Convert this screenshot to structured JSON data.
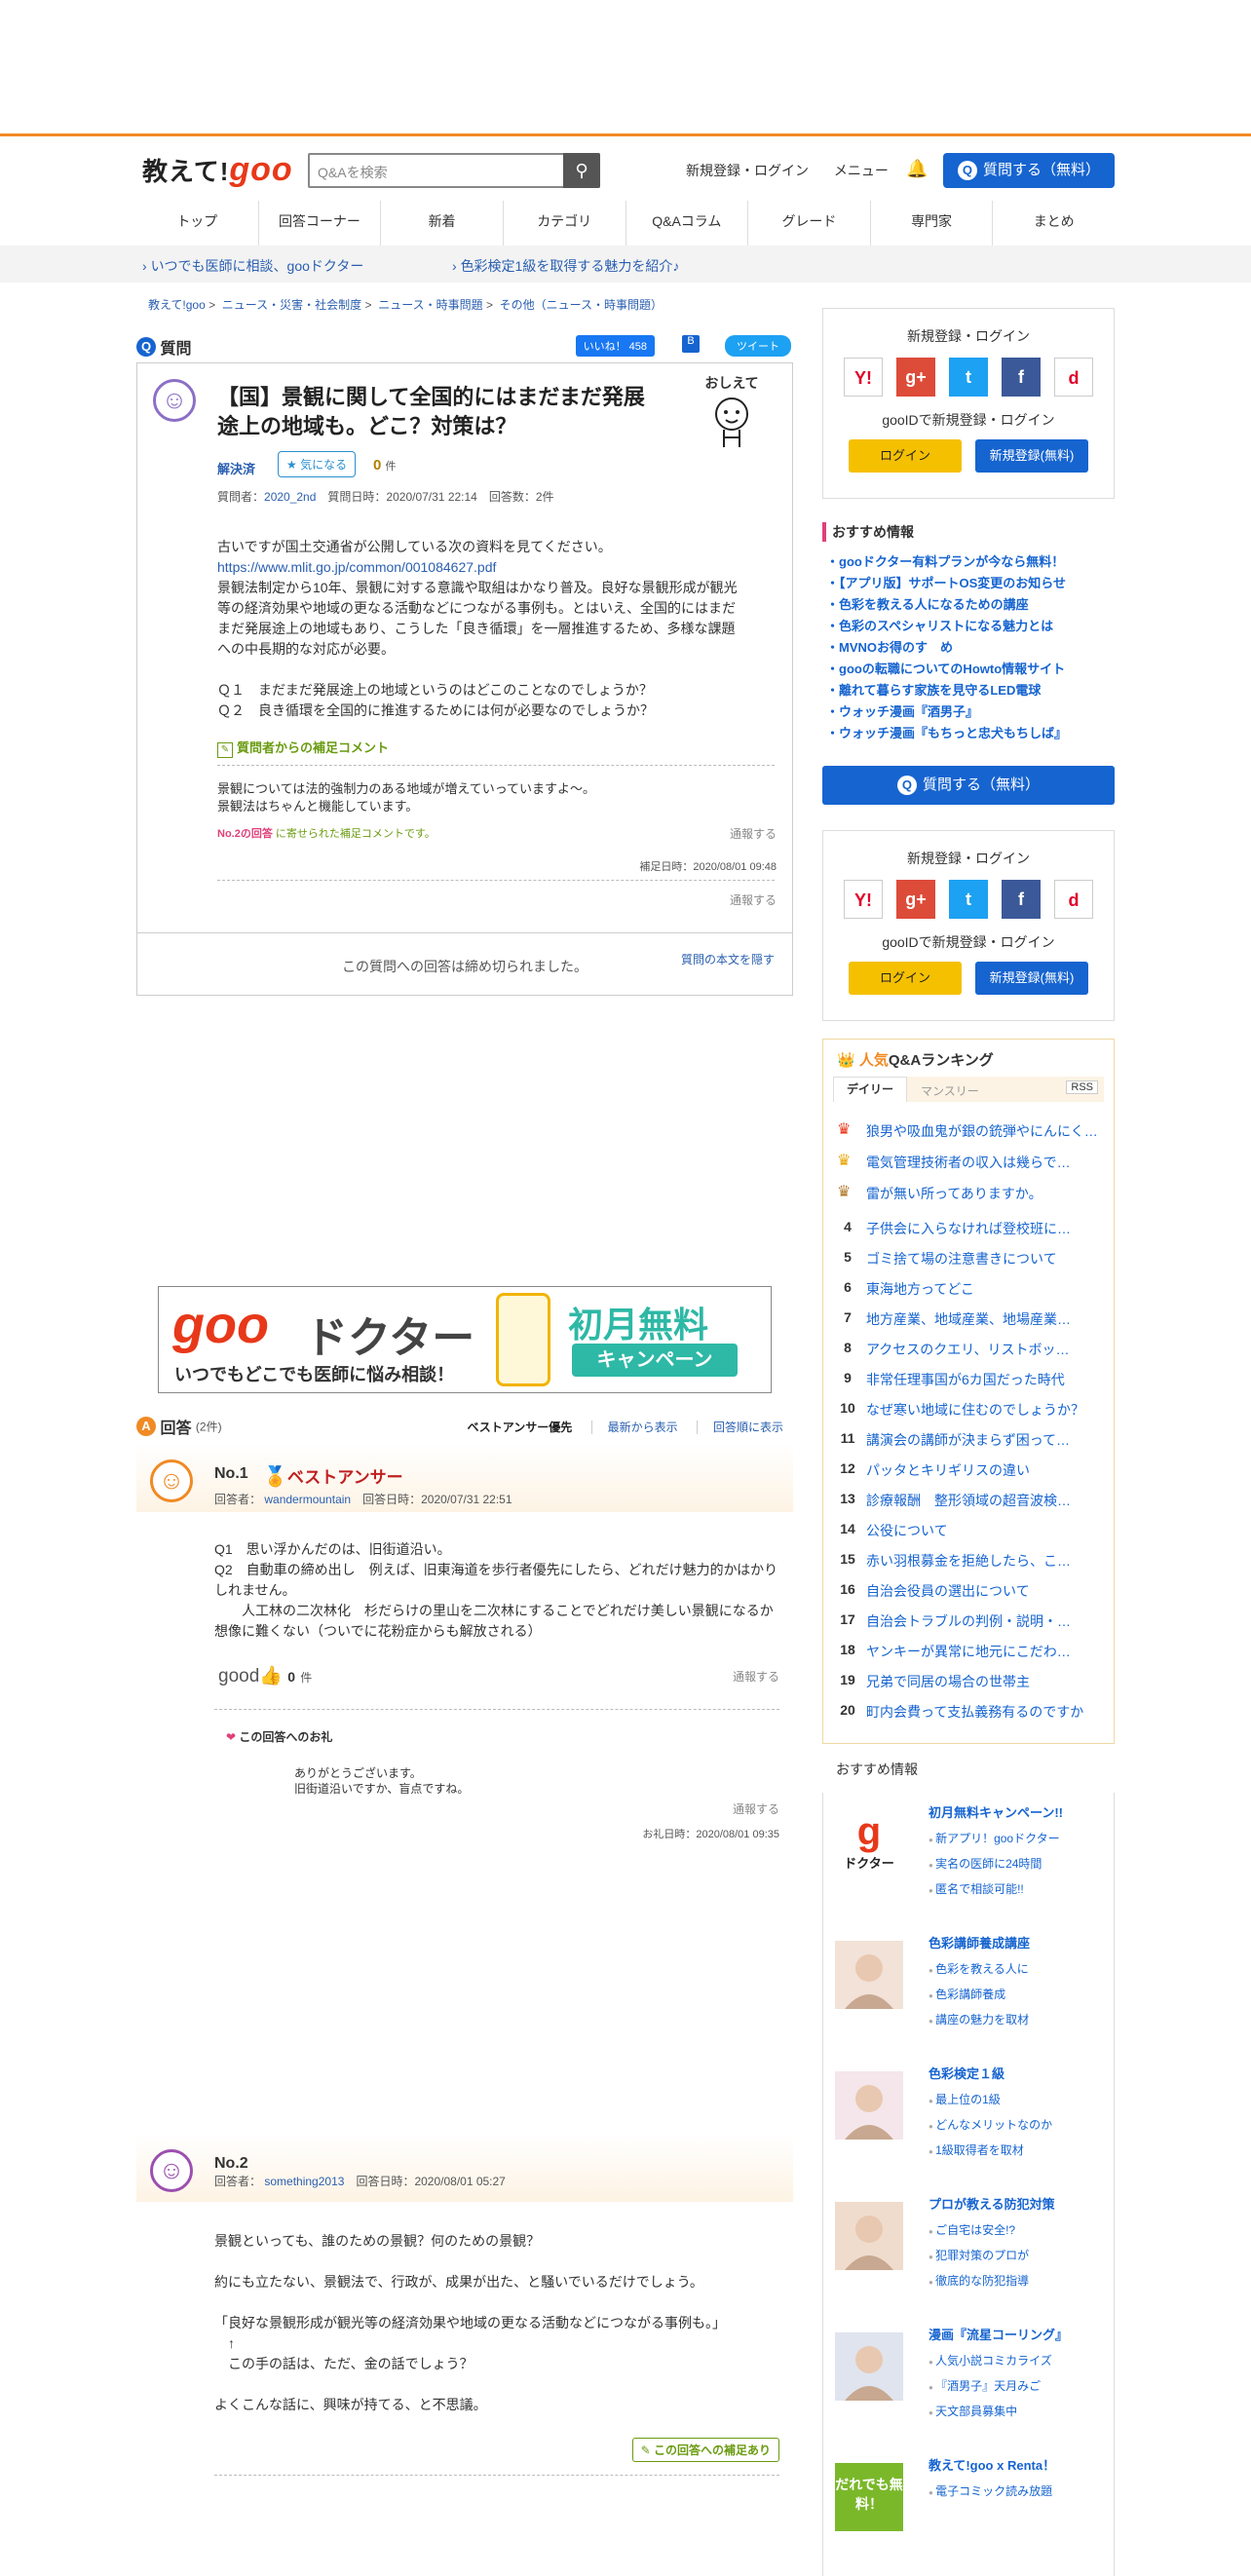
{
  "header": {
    "logo_text": "教えて!",
    "logo_goo": "goo",
    "search_placeholder": "Q&Aを検索",
    "link_login": "新規登録・ログイン",
    "link_menu": "メニュー",
    "ask_button": "質問する（無料）"
  },
  "nav": [
    "トップ",
    "回答コーナー",
    "新着",
    "カテゴリ",
    "Q&Aコラム",
    "グレード",
    "専門家",
    "まとめ"
  ],
  "promo": [
    "いつでも医師に相談、gooドクター",
    "色彩検定1級を取得する魅力を紹介♪"
  ],
  "breadcrumb": [
    "教えて!goo",
    "ニュース・災害・社会制度",
    "ニュース・時事問題",
    "その他（ニュース・時事問題）"
  ],
  "question": {
    "section_label": "質問",
    "like_label": "いいね！ 458",
    "tweet_label": "ツイート",
    "title": "【国】景観に関して全国的にはまだまだ発展途上の地域も。どこ？対策は？",
    "mascot_text": "おしえて",
    "status": "解決済",
    "kininaru_label": "気になる",
    "kininaru_count": "0",
    "kininaru_unit": "件",
    "meta_prefix": "質問者：",
    "author": "2020_2nd",
    "meta_rest": "質問日時：2020/07/31 22:14　回答数：2件",
    "body_1": "古いですが国土交通省が公開している次の資料を見てください。",
    "body_link": "https://www.mlit.go.jp/common/001084627.pdf",
    "body_2": "景観法制定から10年、景観に対する意識や取組はかなり普及。良好な景観形成が観光等の経済効果や地域の更なる活動などにつながる事例も。とはいえ、全国的にはまだまだ発展途上の地域もあり、こうした「良き循環」を一層推進するため、多様な課題への中長期的な対応が必要。",
    "q1": "Ｑ１　まだまだ発展途上の地域というのはどこのことなのでしょうか？",
    "q2": "Ｑ２　良き循環を全国的に推進するためには何が必要なのでしょうか？",
    "supplement_title": "質問者からの補足コメント",
    "supplement_body": "景観については法的強制力のある地域が増えていっていますよ～。\n景観法はちゃんと機能しています。",
    "supp_no2": "No.2の回答",
    "supp_no2_rest": "に寄せられた補足コメントです。",
    "report": "通報する",
    "supp_date": "補足日時：2020/08/01 09:48",
    "closed_text": "この質問への回答は締め切られました。",
    "hide_text": "質問の本文を隠す"
  },
  "banner": {
    "goo": "goo",
    "doctor": "ドクター",
    "sub": "いつでもどこでも医師に悩み相談！",
    "campaign": "初月無料",
    "campaign_sub": "キャンペーン"
  },
  "answers": {
    "section_label": "回答",
    "count": "(2件)",
    "sorts": [
      "ベストアンサー優先",
      "最新から表示",
      "回答順に表示"
    ],
    "a1": {
      "no": "No.1",
      "best": "ベストアンサー",
      "meta_prefix": "回答者：",
      "author": "wandermountain",
      "date": "回答日時：2020/07/31 22:51",
      "body_1": "Q1　思い浮かんだのは、旧街道沿い。",
      "body_2": "Q2　自動車の締め出し　例えば、旧東海道を歩行者優先にしたら、どれだけ魅力的かはかりしれません。",
      "body_3": "　　人工林の二次林化　杉だらけの里山を二次林にすることでどれだけ美しい景観になるか想像に難くない（ついでに花粉症からも解放される）",
      "good": "good",
      "good_count": "0",
      "good_unit": "件",
      "report": "通報する",
      "thanks_title": "この回答へのお礼",
      "thanks_body": "ありがとうございます。\n旧街道沿いですか、盲点ですね。",
      "thanks_date": "お礼日時：2020/08/01 09:35"
    },
    "a2": {
      "no": "No.2",
      "meta_prefix": "回答者：",
      "author": "something2013",
      "date": "回答日時：2020/08/01 05:27",
      "body_1": "景観といっても、誰のための景観？何のための景観？",
      "body_2": "約にも立たない、景観法で、行政が、成果が出た、と騒いでいるだけでしょう。",
      "body_3": "「良好な景観形成が観光等の経済効果や地域の更なる活動などにつながる事例も。」",
      "body_4": "　↑",
      "body_5": "　この手の話は、ただ、金の話でしょう？",
      "body_6": "よくこんな話に、興味が持てる、と不思議。",
      "supp_btn": "この回答への補足あり"
    }
  },
  "sidebar": {
    "login_title": "新規登録・ログイン",
    "gooid": "gooIDで新規登録・ログイン",
    "login_btn": "ログイン",
    "register_btn": "新規登録(無料)",
    "socials": [
      "Y!",
      "g+",
      "t",
      "f",
      "d"
    ],
    "rec_title": "おすすめ情報",
    "rec_items": [
      "・gooドクター有料プランが今なら無料！",
      "・【アプリ版】サポートOS変更のお知らせ",
      "・色彩を教える人になるための講座",
      "・色彩のスペシャリストになる魅力とは",
      "・MVNOお得のす　め",
      "・gooの転職についてのHowto情報サイト",
      "・離れて暮らす家族を見守るLED電球",
      "・ウォッチ漫画『酒男子』",
      "・ウォッチ漫画『もちっと忠犬もちしば』"
    ],
    "ask_button": "質問する（無料）",
    "ranking_title_pop": "人気",
    "ranking_title_rest": "Q&Aランキング",
    "tab_daily": "デイリー",
    "tab_monthly": "マンスリー",
    "rss": "RSS",
    "ranking": [
      "狼男や吸血鬼が銀の銃弾やにんにく…",
      "電気管理技術者の収入は幾らで…",
      "雷が無い所ってありますか。",
      "子供会に入らなければ登校班に…",
      "ゴミ捨て場の注意書きについて",
      "東海地方ってどこ",
      "地方産業、地域産業、地場産業…",
      "アクセスのクエリ、リストボッ…",
      "非常任理事国が6カ国だった時代",
      "なぜ寒い地域に住むのでしょうか？",
      "講演会の講師が決まらず困って…",
      "パッタとキリギリスの違い",
      "診療報酬　整形領域の超音波検…",
      "公役について",
      "赤い羽根募金を拒絶したら、こ…",
      "自治会役員の選出について",
      "自治会トラブルの判例・説明・…",
      "ヤンキーが異常に地元にこだわ…",
      "兄弟で同居の場合の世帯主",
      "町内会費って支払義務有るのですか"
    ],
    "reco2_title": "おすすめ情報",
    "reco2": [
      {
        "title": "初月無料キャンペーン!!",
        "items": [
          "新アプリ！gooドクター",
          "実名の医師に24時間",
          "匿名で相談可能!!"
        ]
      },
      {
        "title": "色彩講師養成講座",
        "items": [
          "色彩を教える人に",
          "色彩講師養成",
          "講座の魅力を取材"
        ]
      },
      {
        "title": "色彩検定１級",
        "items": [
          "最上位の1級",
          "どんなメリットなのか",
          "1級取得者を取材"
        ]
      },
      {
        "title": "プロが教える防犯対策",
        "items": [
          "ご自宅は安全!?",
          "犯罪対策のプロが",
          "徹底的な防犯指導"
        ]
      },
      {
        "title": "漫画『流星コーリング』",
        "items": [
          "人気小説コミカライズ",
          "『酒男子』天月みご",
          "天文部員募集中"
        ]
      },
      {
        "title": "教えて!goo x Renta！",
        "items": [
          "電子コミック読み放題"
        ]
      }
    ],
    "doctor_logo": "ドクター",
    "renta_logo": "だれでも無料！"
  },
  "colors": {
    "accent": "#f08a24",
    "brand_blue": "#1664d0",
    "goo_red": "#e8381a"
  }
}
